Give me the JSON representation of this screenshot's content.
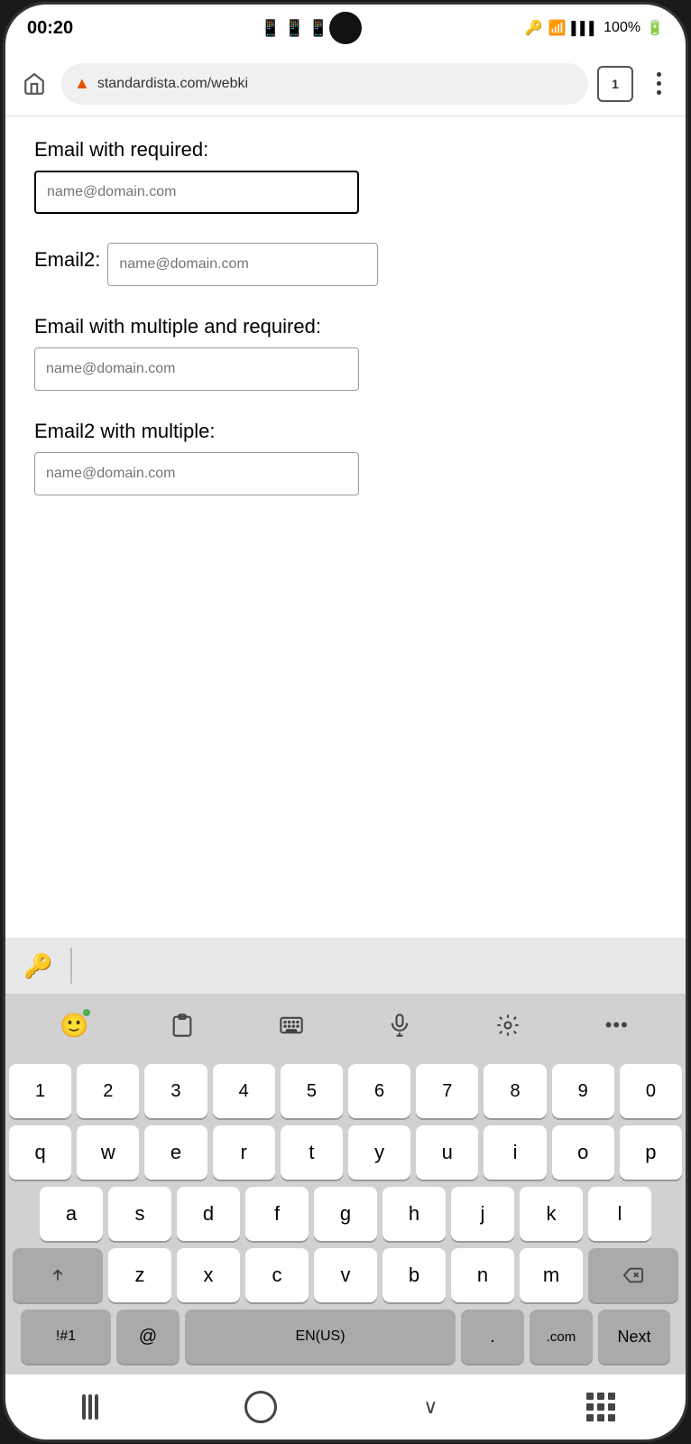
{
  "status_bar": {
    "time": "00:20",
    "battery": "100%",
    "tab_count": "1"
  },
  "browser": {
    "url": "standardista.com/webki"
  },
  "form": {
    "field1_label": "Email with required:",
    "field1_placeholder": "name@domain.com",
    "field2_label": "Email2:",
    "field2_placeholder": "name@domain.com",
    "field3_label": "Email with multiple and required:",
    "field3_placeholder": "name@domain.com",
    "field4_label": "Email2 with multiple:",
    "field4_placeholder": "name@domain.com"
  },
  "keyboard": {
    "row1": [
      "1",
      "2",
      "3",
      "4",
      "5",
      "6",
      "7",
      "8",
      "9",
      "0"
    ],
    "row2": [
      "q",
      "w",
      "e",
      "r",
      "t",
      "y",
      "u",
      "i",
      "o",
      "p"
    ],
    "row3": [
      "a",
      "s",
      "d",
      "f",
      "g",
      "h",
      "j",
      "k",
      "l"
    ],
    "row4": [
      "z",
      "x",
      "c",
      "v",
      "b",
      "n",
      "m"
    ],
    "special_keys": {
      "symbols": "!#1",
      "at": "@",
      "space": "EN(US)",
      "period": ".",
      "dot_com": ".com",
      "next": "Next"
    }
  }
}
